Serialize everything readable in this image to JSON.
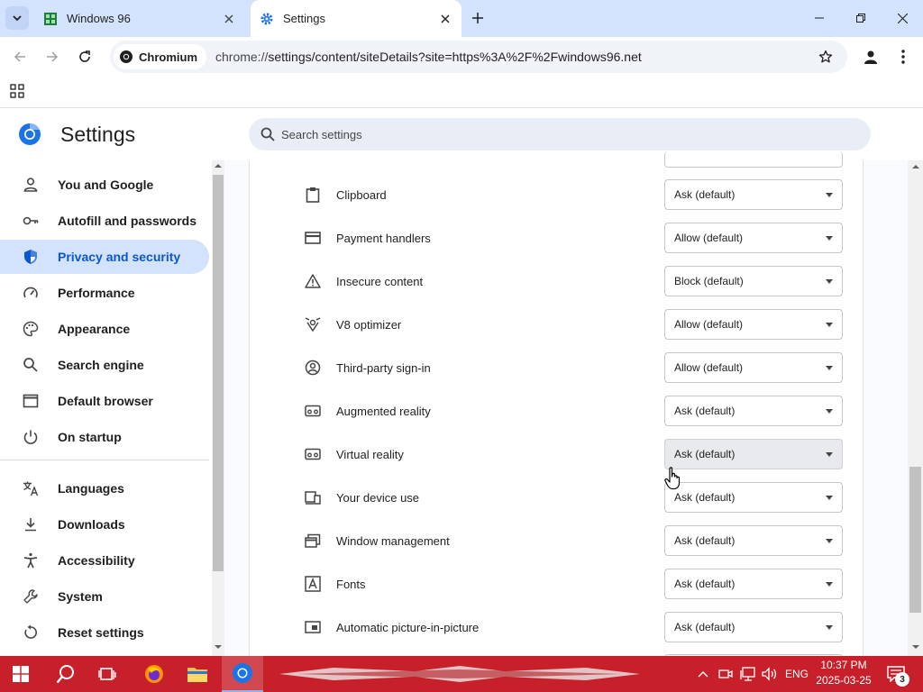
{
  "browser": {
    "tabs": [
      {
        "title": "Windows 96",
        "icon": "windows96-favicon"
      },
      {
        "title": "Settings",
        "icon": "gear-icon",
        "active": true
      }
    ],
    "omnibox": {
      "chip_label": "Chromium",
      "url_scheme": "chrome://",
      "url_rest": "settings/content/siteDetails?site=https%3A%2F%2Fwindows96.net"
    }
  },
  "settings": {
    "title": "Settings",
    "search_placeholder": "Search settings"
  },
  "sidebar": {
    "items": [
      {
        "label": "You and Google",
        "icon": "person-icon"
      },
      {
        "label": "Autofill and passwords",
        "icon": "key-icon"
      },
      {
        "label": "Privacy and security",
        "icon": "shield-icon",
        "active": true
      },
      {
        "label": "Performance",
        "icon": "speedometer-icon"
      },
      {
        "label": "Appearance",
        "icon": "palette-icon"
      },
      {
        "label": "Search engine",
        "icon": "search-icon"
      },
      {
        "label": "Default browser",
        "icon": "browser-window-icon"
      },
      {
        "label": "On startup",
        "icon": "power-icon"
      },
      {
        "label": "Languages",
        "icon": "translate-icon"
      },
      {
        "label": "Downloads",
        "icon": "download-icon"
      },
      {
        "label": "Accessibility",
        "icon": "accessibility-icon"
      },
      {
        "label": "System",
        "icon": "wrench-icon"
      },
      {
        "label": "Reset settings",
        "icon": "reset-icon"
      }
    ]
  },
  "permissions": [
    {
      "label": "Clipboard",
      "value": "Ask (default)",
      "icon": "clipboard-icon"
    },
    {
      "label": "Payment handlers",
      "value": "Allow (default)",
      "icon": "credit-card-icon"
    },
    {
      "label": "Insecure content",
      "value": "Block (default)",
      "icon": "warning-icon"
    },
    {
      "label": "V8 optimizer",
      "value": "Allow (default)",
      "icon": "v8-icon"
    },
    {
      "label": "Third-party sign-in",
      "value": "Allow (default)",
      "icon": "account-circle-icon"
    },
    {
      "label": "Augmented reality",
      "value": "Ask (default)",
      "icon": "vr-headset-icon"
    },
    {
      "label": "Virtual reality",
      "value": "Ask (default)",
      "icon": "vr-headset-icon",
      "hovered": true
    },
    {
      "label": "Your device use",
      "value": "Ask (default)",
      "icon": "devices-icon"
    },
    {
      "label": "Window management",
      "value": "Ask (default)",
      "icon": "windows-icon"
    },
    {
      "label": "Fonts",
      "value": "Ask (default)",
      "icon": "font-icon"
    },
    {
      "label": "Automatic picture-in-picture",
      "value": "Ask (default)",
      "icon": "picture-in-picture-icon"
    }
  ],
  "taskbar": {
    "language": "ENG",
    "time": "10:37 PM",
    "date": "2025-03-25",
    "notification_count": "3",
    "color": "#c8202a"
  }
}
